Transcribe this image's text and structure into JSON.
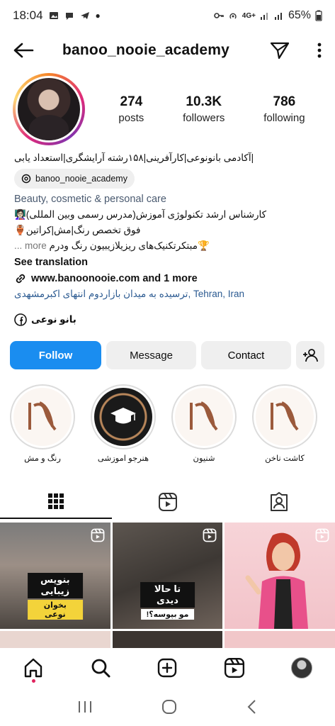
{
  "status_bar": {
    "time": "18:04",
    "battery": "65%",
    "network": "4G+"
  },
  "header": {
    "username": "banoo_nooie_academy"
  },
  "profile": {
    "posts_count": "274",
    "posts_label": "posts",
    "followers_count": "10.3K",
    "followers_label": "followers",
    "following_count": "786",
    "following_label": "following"
  },
  "bio": {
    "name_line": "|آکادمی بانونوعی|کارآفرینی|۱۵۸رشته آرایشگری|استعداد یابی",
    "threads_handle": "banoo_nooie_academy",
    "category": "Beauty, cosmetic & personal care",
    "line1": "کارشناس ارشد تکنولوژی آموزش(مدرس رسمی وبین المللی)👩🏻‍🏫",
    "line2": "فوق تخصص رنگ|مش|کراتین🏺",
    "line3_text": "مبتکرتکنیک‌های ریزیلازیبیون رنگ ودرم🏆",
    "line3_more": "... more",
    "see_translation": "See translation",
    "link_text": "www.banoonooie.com and 1 more",
    "location_prefix": "ترسیده به میدان بازاردوم انتهای اکبرمشهدی,",
    "location_city": "Tehran, Iran",
    "facebook_name": "بانو نوعی"
  },
  "actions": {
    "follow": "Follow",
    "message": "Message",
    "contact": "Contact"
  },
  "highlights": [
    {
      "label": "رنگ و مش"
    },
    {
      "label": "هنرجو اموزشی"
    },
    {
      "label": "شنیون"
    },
    {
      "label": "کاشت ناخن"
    }
  ],
  "grid": {
    "post1_line1": "بنویس زیبایی",
    "post1_line2": "بخوان نوعی",
    "post2_line1": "تا حالا دیدی",
    "post2_line2": "مو بپوسه؟!"
  },
  "colors": {
    "follow_blue": "#1a8df0",
    "link_blue": "#2b5a91",
    "notification_dot": "#e0245e"
  }
}
